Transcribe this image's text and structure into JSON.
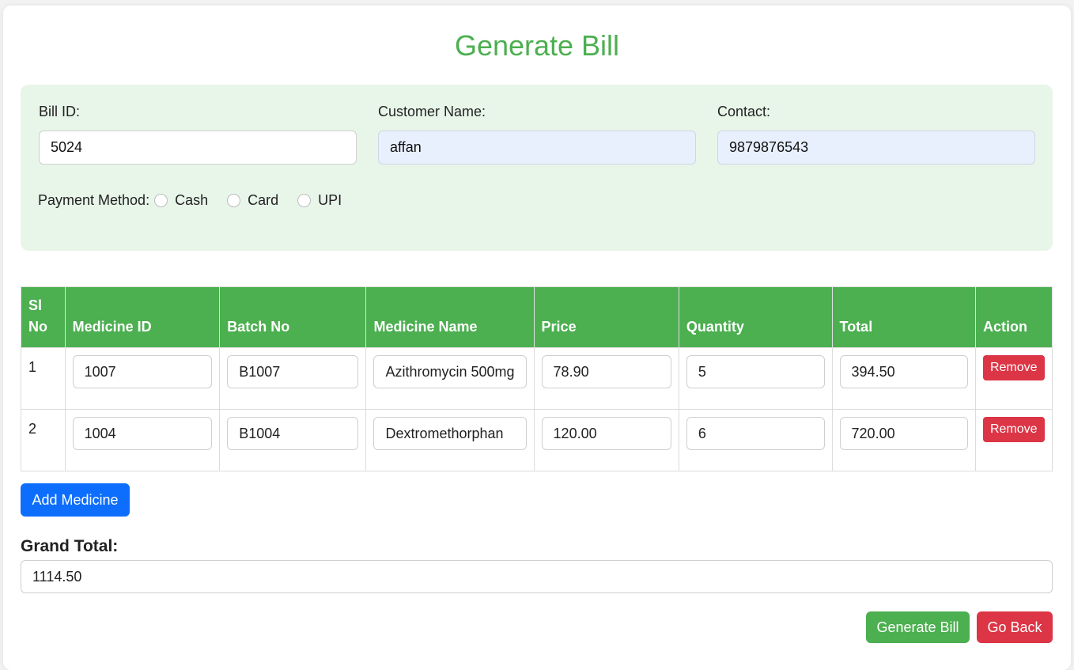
{
  "page_title": "Generate Bill",
  "form": {
    "bill_id": {
      "label": "Bill ID:",
      "value": "5024"
    },
    "customer_name": {
      "label": "Customer Name:",
      "value": "affan"
    },
    "contact": {
      "label": "Contact:",
      "value": "9879876543"
    },
    "payment": {
      "label": "Payment Method:",
      "options": [
        "Cash",
        "Card",
        "UPI"
      ]
    }
  },
  "table": {
    "headers": {
      "sl_no": "Sl No",
      "medicine_id": "Medicine ID",
      "batch_no": "Batch No",
      "medicine_name": "Medicine Name",
      "price": "Price",
      "quantity": "Quantity",
      "total": "Total",
      "action": "Action"
    },
    "rows": [
      {
        "sl": "1",
        "medicine_id": "1007",
        "batch_no": "B1007",
        "medicine_name": "Azithromycin 500mg",
        "price": "78.90",
        "quantity": "5",
        "total": "394.50",
        "action": "Remove"
      },
      {
        "sl": "2",
        "medicine_id": "1004",
        "batch_no": "B1004",
        "medicine_name": "Dextromethorphan",
        "price": "120.00",
        "quantity": "6",
        "total": "720.00",
        "action": "Remove"
      }
    ]
  },
  "add_medicine_label": "Add Medicine",
  "grand_total": {
    "label": "Grand Total:",
    "value": "1114.50"
  },
  "generate_bill_label": "Generate Bill",
  "go_back_label": "Go Back",
  "colors": {
    "accent_green": "#4caf50",
    "primary_blue": "#0d6efd",
    "danger_red": "#dc3545",
    "panel_bg": "#e8f5e9"
  }
}
